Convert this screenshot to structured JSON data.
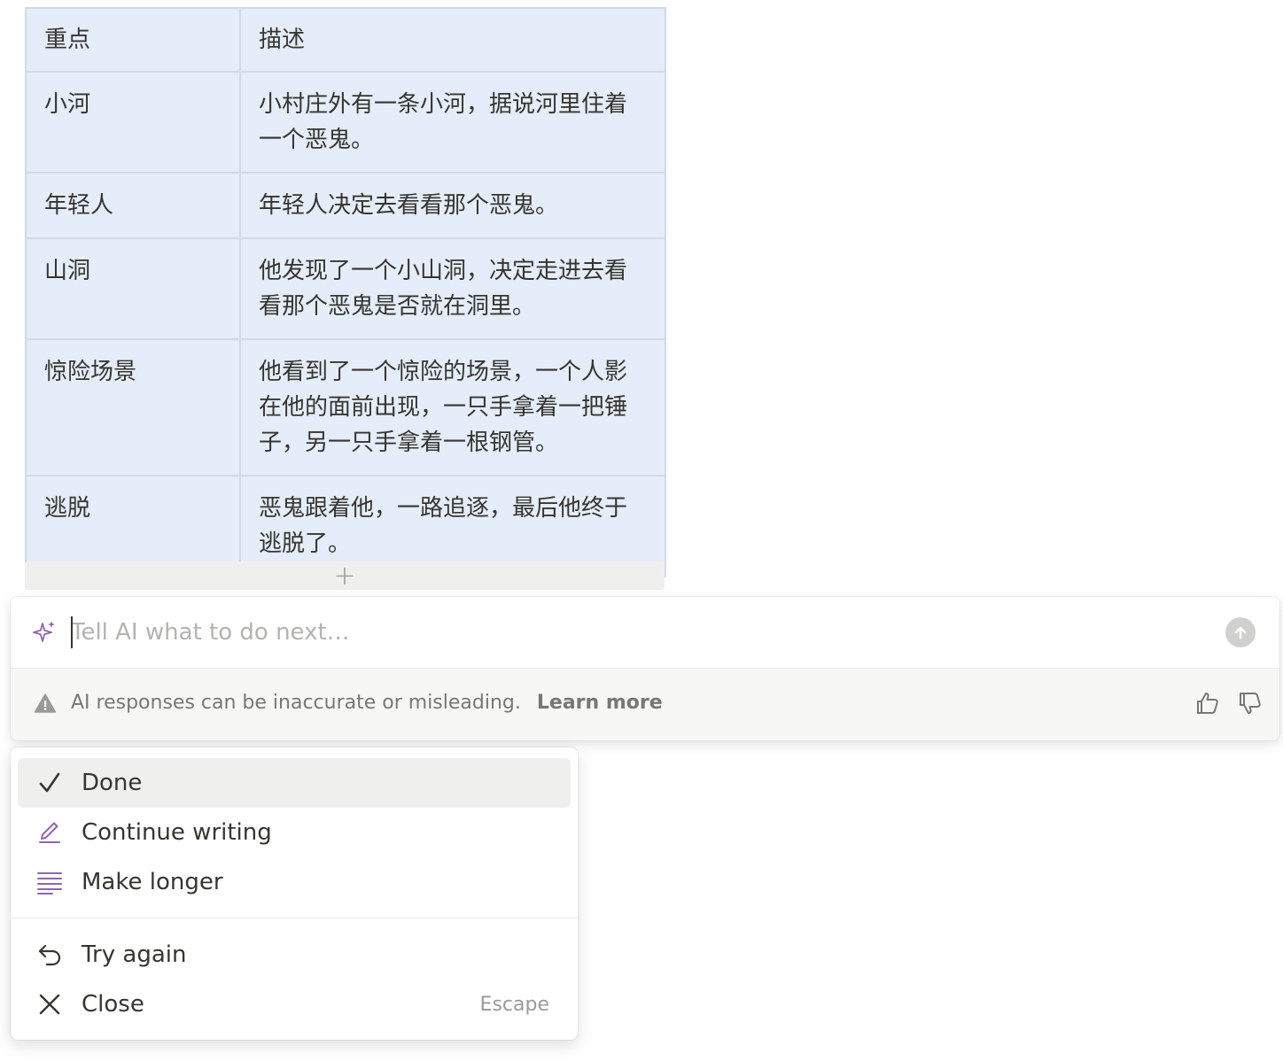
{
  "table": {
    "header": [
      "重点",
      "描述"
    ],
    "rows": [
      [
        "小河",
        "小村庄外有一条小河，据说河里住着一个恶鬼。"
      ],
      [
        "年轻人",
        "年轻人决定去看看那个恶鬼。"
      ],
      [
        "山洞",
        "他发现了一个小山洞，决定走进去看看那个恶鬼是否就在洞里。"
      ],
      [
        "惊险场景",
        "他看到了一个惊险的场景，一个人影在他的面前出现，一只手拿着一把锤子，另一只手拿着一根钢管。"
      ],
      [
        "逃脱",
        "恶鬼跟着他，一路追逐，最后他终于逃脱了。"
      ]
    ],
    "add_row_label": "+"
  },
  "ai_panel": {
    "input_placeholder": "Tell AI what to do next…",
    "input_value": "",
    "icons": {
      "sparkle": "sparkle-icon",
      "send": "arrow-up-icon"
    },
    "disclaimer": "AI responses can be inaccurate or misleading.",
    "learn_more": "Learn more",
    "feedback_icons": [
      "thumbs-up-icon",
      "thumbs-down-icon"
    ]
  },
  "menu": {
    "items": [
      {
        "label": "Done",
        "icon": "check-icon",
        "active": true
      },
      {
        "label": "Continue writing",
        "icon": "pen-icon"
      },
      {
        "label": "Make longer",
        "icon": "lines-icon"
      },
      {
        "label": "Try again",
        "icon": "undo-icon"
      },
      {
        "label": "Close",
        "icon": "close-icon",
        "shortcut": "Escape"
      }
    ]
  },
  "colors": {
    "accent_purple": "#9065b0",
    "table_bg": "#e4edf9",
    "text": "#37352f",
    "muted": "#787774"
  }
}
